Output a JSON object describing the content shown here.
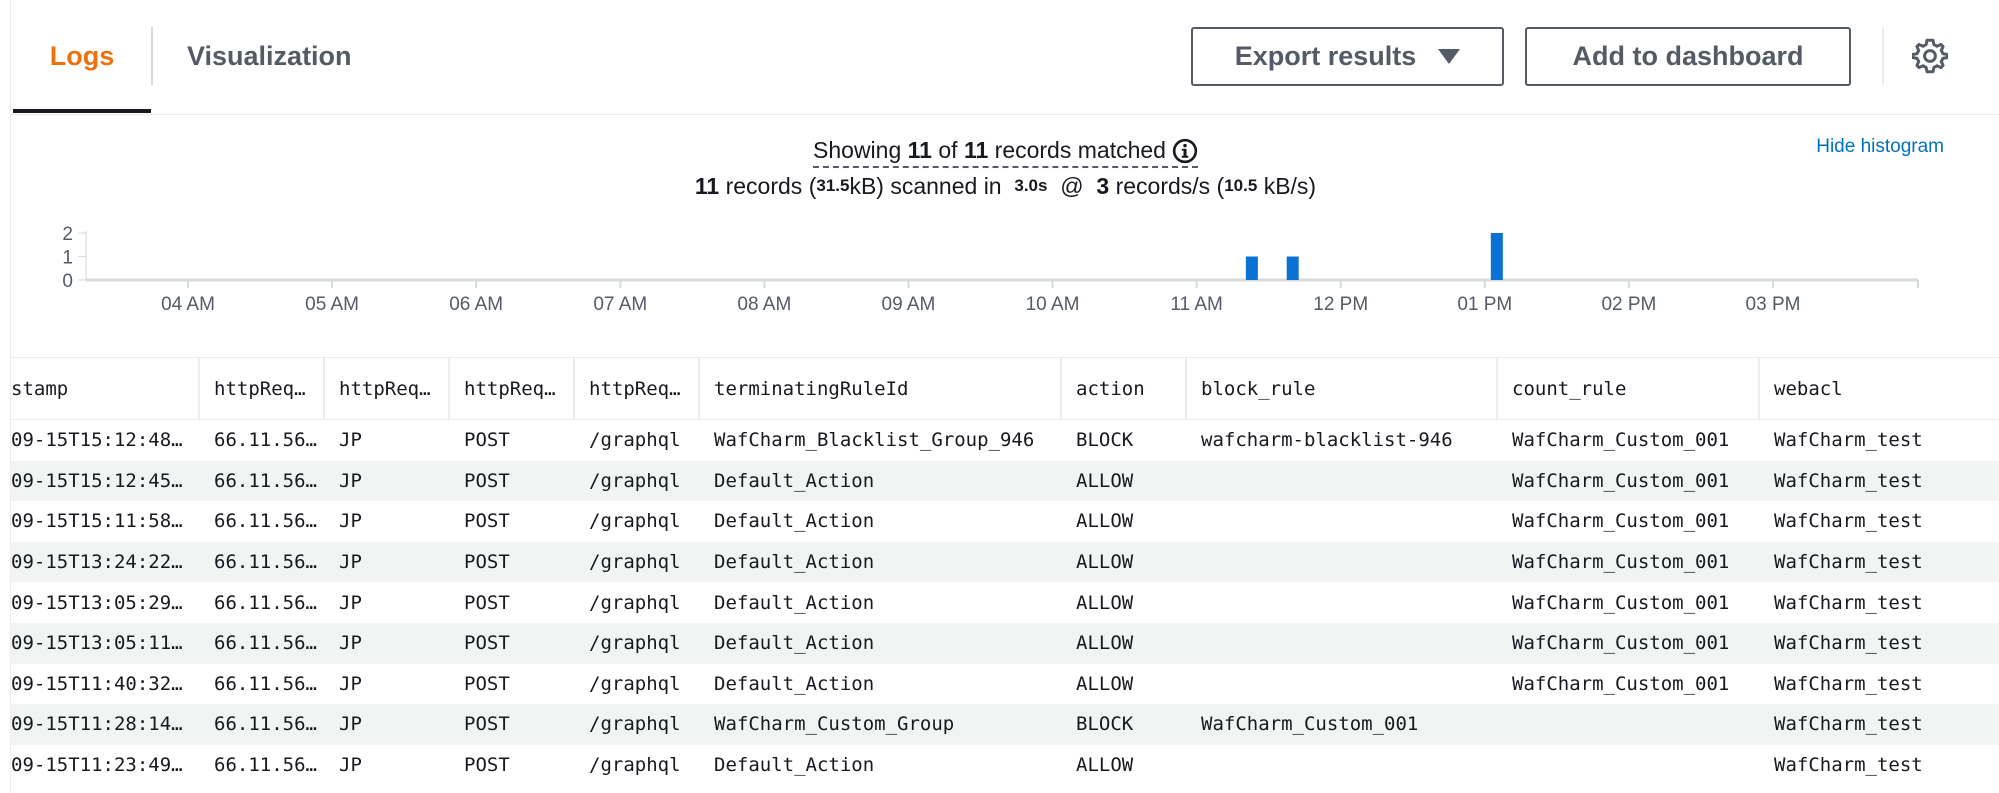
{
  "tabs": [
    {
      "label": "Logs",
      "active": true
    },
    {
      "label": "Visualization",
      "active": false
    }
  ],
  "toolbar": {
    "export_label": "Export results",
    "dashboard_label": "Add to dashboard"
  },
  "icons": {
    "settings": "gear-icon",
    "info": "info-icon",
    "dropdown": "caret-down-icon"
  },
  "colors": {
    "accent": "#ec7211",
    "link": "#0073bb",
    "bar": "#0972d3"
  },
  "summary": {
    "showing_prefix": "Showing",
    "shown": "11",
    "of": "of",
    "total": "11",
    "matched_suffix": "records matched",
    "scanned_records": "11",
    "records_word": "records (",
    "scanned_size": "31.5",
    "scanned_mid": "kB) scanned in",
    "scanned_time": "3.0s",
    "at": "@",
    "rate": "3",
    "rate_mid": "records/s (",
    "rate_size": "10.5",
    "rate_suffix": "kB/s)"
  },
  "hide_histogram": "Hide histogram",
  "chart_data": {
    "type": "bar",
    "x_ticks": [
      "04 AM",
      "05 AM",
      "06 AM",
      "07 AM",
      "08 AM",
      "09 AM",
      "10 AM",
      "11 AM",
      "12 PM",
      "01 PM",
      "02 PM",
      "03 PM"
    ],
    "y_ticks": [
      0,
      1,
      2
    ],
    "ylim": [
      0,
      2
    ],
    "grid": false,
    "bars": [
      {
        "x": "11:23 AM",
        "value": 1
      },
      {
        "x": "11:40 AM",
        "value": 1
      },
      {
        "x": "01:05 PM",
        "value": 2
      }
    ]
  },
  "table": {
    "columns": [
      "stamp",
      "httpReq…",
      "httpReq…",
      "httpReq…",
      "httpReq…",
      "terminatingRuleId",
      "action",
      "block_rule",
      "count_rule",
      "webacl"
    ],
    "rows": [
      [
        "09-15T15:12:48…",
        "66.11.56…",
        "JP",
        "POST",
        "/graphql",
        "WafCharm_Blacklist_Group_946",
        "BLOCK",
        "wafcharm-blacklist-946",
        "WafCharm_Custom_001",
        "WafCharm_test"
      ],
      [
        "09-15T15:12:45…",
        "66.11.56…",
        "JP",
        "POST",
        "/graphql",
        "Default_Action",
        "ALLOW",
        "",
        "WafCharm_Custom_001",
        "WafCharm_test"
      ],
      [
        "09-15T15:11:58…",
        "66.11.56…",
        "JP",
        "POST",
        "/graphql",
        "Default_Action",
        "ALLOW",
        "",
        "WafCharm_Custom_001",
        "WafCharm_test"
      ],
      [
        "09-15T13:24:22…",
        "66.11.56…",
        "JP",
        "POST",
        "/graphql",
        "Default_Action",
        "ALLOW",
        "",
        "WafCharm_Custom_001",
        "WafCharm_test"
      ],
      [
        "09-15T13:05:29…",
        "66.11.56…",
        "JP",
        "POST",
        "/graphql",
        "Default_Action",
        "ALLOW",
        "",
        "WafCharm_Custom_001",
        "WafCharm_test"
      ],
      [
        "09-15T13:05:11…",
        "66.11.56…",
        "JP",
        "POST",
        "/graphql",
        "Default_Action",
        "ALLOW",
        "",
        "WafCharm_Custom_001",
        "WafCharm_test"
      ],
      [
        "09-15T11:40:32…",
        "66.11.56…",
        "JP",
        "POST",
        "/graphql",
        "Default_Action",
        "ALLOW",
        "",
        "WafCharm_Custom_001",
        "WafCharm_test"
      ],
      [
        "09-15T11:28:14…",
        "66.11.56…",
        "JP",
        "POST",
        "/graphql",
        "WafCharm_Custom_Group",
        "BLOCK",
        "WafCharm_Custom_001",
        "",
        "WafCharm_test"
      ],
      [
        "09-15T11:23:49…",
        "66.11.56…",
        "JP",
        "POST",
        "/graphql",
        "Default_Action",
        "ALLOW",
        "",
        "",
        "WafCharm_test"
      ]
    ]
  }
}
